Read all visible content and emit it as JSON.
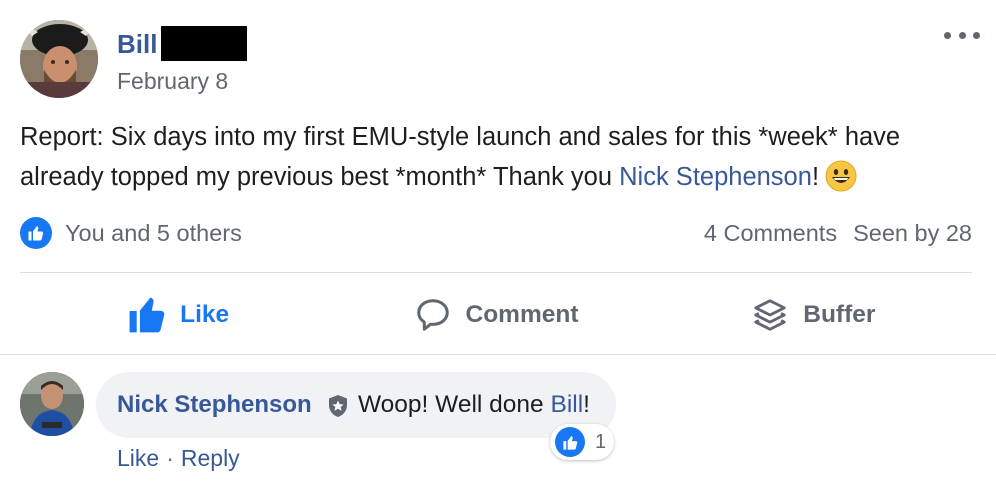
{
  "post": {
    "author": "Bill",
    "date": "February 8",
    "text_before": "Report: Six days into my first EMU-style launch and sales for this *week* have already topped my previous best *month* Thank you ",
    "mention": "Nick Stephenson",
    "text_after": "!",
    "emoji": "grinning-face-emoji"
  },
  "reactions": {
    "summary": "You and 5 others",
    "comments": "4 Comments",
    "seen": "Seen by 28"
  },
  "actions": {
    "like": "Like",
    "comment": "Comment",
    "buffer": "Buffer"
  },
  "comment": {
    "author": "Nick Stephenson",
    "text_before": "Woop! Well done ",
    "mention": "Bill",
    "text_after": "!",
    "like_count": "1",
    "like_label": "Like",
    "separator": "·",
    "reply_label": "Reply"
  },
  "colors": {
    "link": "#385898",
    "accent": "#1877f2",
    "muted": "#606770"
  }
}
